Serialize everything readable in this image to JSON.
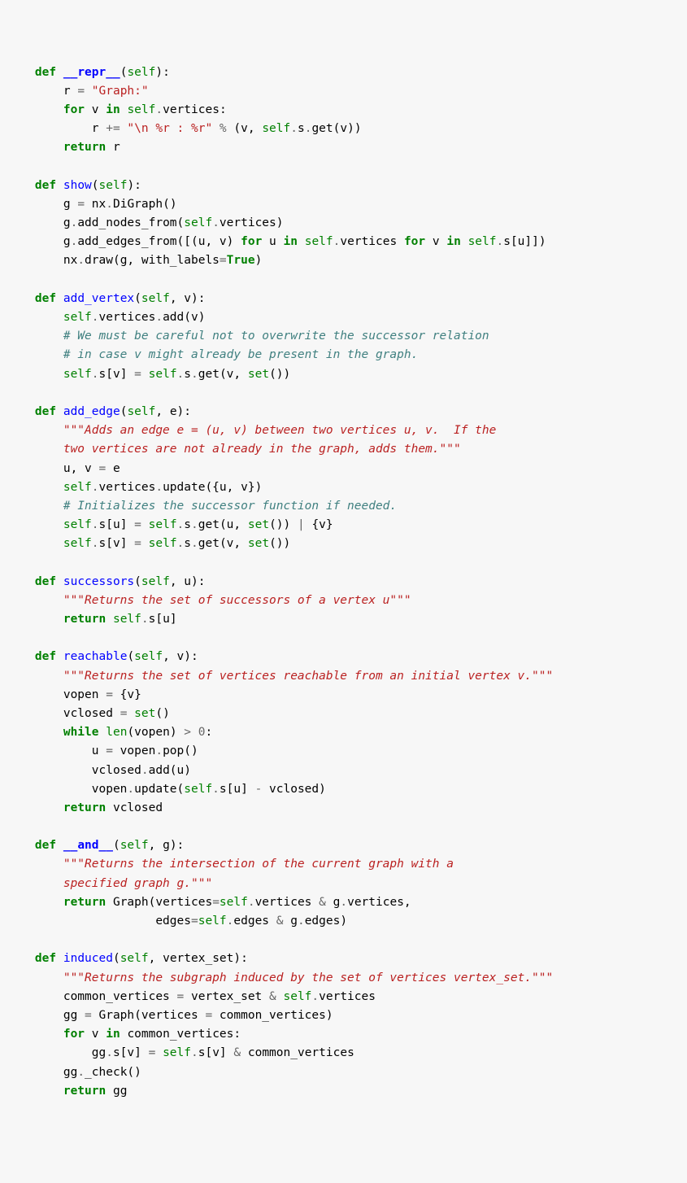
{
  "code_lines": [
    [
      [
        "    "
      ],
      [
        "kw",
        "def"
      ],
      [
        " "
      ],
      [
        "ufn",
        "__repr__"
      ],
      [
        "("
      ],
      [
        "self",
        "self"
      ],
      [
        "):"
      ]
    ],
    [
      [
        "        r "
      ],
      [
        "op",
        "="
      ],
      [
        " "
      ],
      [
        "str",
        "\"Graph:\""
      ]
    ],
    [
      [
        "        "
      ],
      [
        "kw",
        "for"
      ],
      [
        " v "
      ],
      [
        "kw",
        "in"
      ],
      [
        " "
      ],
      [
        "self",
        "self"
      ],
      [
        "op",
        "."
      ],
      [
        "vertices:"
      ]
    ],
    [
      [
        "            r "
      ],
      [
        "op",
        "+="
      ],
      [
        " "
      ],
      [
        "str",
        "\"\\n %r : %r\""
      ],
      [
        " "
      ],
      [
        "op",
        "%"
      ],
      [
        " (v, "
      ],
      [
        "self",
        "self"
      ],
      [
        "op",
        "."
      ],
      [
        "s"
      ],
      [
        "op",
        "."
      ],
      [
        "get(v))"
      ]
    ],
    [
      [
        "        "
      ],
      [
        "kw",
        "return"
      ],
      [
        " r"
      ]
    ],
    [
      [
        ""
      ]
    ],
    [
      [
        "    "
      ],
      [
        "kw",
        "def"
      ],
      [
        " "
      ],
      [
        "fn",
        "show"
      ],
      [
        "("
      ],
      [
        "self",
        "self"
      ],
      [
        "):"
      ]
    ],
    [
      [
        "        g "
      ],
      [
        "op",
        "="
      ],
      [
        " nx"
      ],
      [
        "op",
        "."
      ],
      [
        "DiGraph()"
      ]
    ],
    [
      [
        "        g"
      ],
      [
        "op",
        "."
      ],
      [
        "add_nodes_from("
      ],
      [
        "self",
        "self"
      ],
      [
        "op",
        "."
      ],
      [
        "vertices)"
      ]
    ],
    [
      [
        "        g"
      ],
      [
        "op",
        "."
      ],
      [
        "add_edges_from([(u, v) "
      ],
      [
        "kw",
        "for"
      ],
      [
        " u "
      ],
      [
        "kw",
        "in"
      ],
      [
        " "
      ],
      [
        "self",
        "self"
      ],
      [
        "op",
        "."
      ],
      [
        "vertices "
      ],
      [
        "kw",
        "for"
      ],
      [
        " v "
      ],
      [
        "kw",
        "in"
      ],
      [
        " "
      ],
      [
        "self",
        "self"
      ],
      [
        "op",
        "."
      ],
      [
        "s[u]])"
      ]
    ],
    [
      [
        "        nx"
      ],
      [
        "op",
        "."
      ],
      [
        "draw(g, with_labels"
      ],
      [
        "op",
        "="
      ],
      [
        "bool",
        "True"
      ],
      [
        ")"
      ]
    ],
    [
      [
        ""
      ]
    ],
    [
      [
        "    "
      ],
      [
        "kw",
        "def"
      ],
      [
        " "
      ],
      [
        "fn",
        "add_vertex"
      ],
      [
        "("
      ],
      [
        "self",
        "self"
      ],
      [
        ", v):"
      ]
    ],
    [
      [
        "        "
      ],
      [
        "self",
        "self"
      ],
      [
        "op",
        "."
      ],
      [
        "vertices"
      ],
      [
        "op",
        "."
      ],
      [
        "add(v)"
      ]
    ],
    [
      [
        "        "
      ],
      [
        "cm",
        "# We must be careful not to overwrite the successor relation"
      ]
    ],
    [
      [
        "        "
      ],
      [
        "cm",
        "# in case v might already be present in the graph."
      ]
    ],
    [
      [
        "        "
      ],
      [
        "self",
        "self"
      ],
      [
        "op",
        "."
      ],
      [
        "s[v] "
      ],
      [
        "op",
        "="
      ],
      [
        " "
      ],
      [
        "self",
        "self"
      ],
      [
        "op",
        "."
      ],
      [
        "s"
      ],
      [
        "op",
        "."
      ],
      [
        "get(v, "
      ],
      [
        "bi",
        "set"
      ],
      [
        "())"
      ]
    ],
    [
      [
        ""
      ]
    ],
    [
      [
        "    "
      ],
      [
        "kw",
        "def"
      ],
      [
        " "
      ],
      [
        "fn",
        "add_edge"
      ],
      [
        "("
      ],
      [
        "self",
        "self"
      ],
      [
        ", e):"
      ]
    ],
    [
      [
        "        "
      ],
      [
        "docf",
        "\"\"\"Adds an edge e = (u, v) between two vertices u, v.  If the"
      ]
    ],
    [
      [
        "        "
      ],
      [
        "docf",
        "two vertices are not already in the graph, adds them.\"\"\""
      ]
    ],
    [
      [
        "        u, v "
      ],
      [
        "op",
        "="
      ],
      [
        " e"
      ]
    ],
    [
      [
        "        "
      ],
      [
        "self",
        "self"
      ],
      [
        "op",
        "."
      ],
      [
        "vertices"
      ],
      [
        "op",
        "."
      ],
      [
        "update({u, v})"
      ]
    ],
    [
      [
        "        "
      ],
      [
        "cm",
        "# Initializes the successor function if needed."
      ]
    ],
    [
      [
        "        "
      ],
      [
        "self",
        "self"
      ],
      [
        "op",
        "."
      ],
      [
        "s[u] "
      ],
      [
        "op",
        "="
      ],
      [
        " "
      ],
      [
        "self",
        "self"
      ],
      [
        "op",
        "."
      ],
      [
        "s"
      ],
      [
        "op",
        "."
      ],
      [
        "get(u, "
      ],
      [
        "bi",
        "set"
      ],
      [
        "()) "
      ],
      [
        "op",
        "|"
      ],
      [
        " {v}"
      ]
    ],
    [
      [
        "        "
      ],
      [
        "self",
        "self"
      ],
      [
        "op",
        "."
      ],
      [
        "s[v] "
      ],
      [
        "op",
        "="
      ],
      [
        " "
      ],
      [
        "self",
        "self"
      ],
      [
        "op",
        "."
      ],
      [
        "s"
      ],
      [
        "op",
        "."
      ],
      [
        "get(v, "
      ],
      [
        "bi",
        "set"
      ],
      [
        "())"
      ]
    ],
    [
      [
        ""
      ]
    ],
    [
      [
        "    "
      ],
      [
        "kw",
        "def"
      ],
      [
        " "
      ],
      [
        "fn",
        "successors"
      ],
      [
        "("
      ],
      [
        "self",
        "self"
      ],
      [
        ", u):"
      ]
    ],
    [
      [
        "        "
      ],
      [
        "docf",
        "\"\"\"Returns the set of successors of a vertex u\"\"\""
      ]
    ],
    [
      [
        "        "
      ],
      [
        "kw",
        "return"
      ],
      [
        " "
      ],
      [
        "self",
        "self"
      ],
      [
        "op",
        "."
      ],
      [
        "s[u]"
      ]
    ],
    [
      [
        ""
      ]
    ],
    [
      [
        "    "
      ],
      [
        "kw",
        "def"
      ],
      [
        " "
      ],
      [
        "fn",
        "reachable"
      ],
      [
        "("
      ],
      [
        "self",
        "self"
      ],
      [
        ", v):"
      ]
    ],
    [
      [
        "        "
      ],
      [
        "docf",
        "\"\"\"Returns the set of vertices reachable from an initial vertex v.\"\"\""
      ]
    ],
    [
      [
        "        vopen "
      ],
      [
        "op",
        "="
      ],
      [
        " {v}"
      ]
    ],
    [
      [
        "        vclosed "
      ],
      [
        "op",
        "="
      ],
      [
        " "
      ],
      [
        "bi",
        "set"
      ],
      [
        "()"
      ]
    ],
    [
      [
        "        "
      ],
      [
        "kw",
        "while"
      ],
      [
        " "
      ],
      [
        "bi",
        "len"
      ],
      [
        "(vopen) "
      ],
      [
        "op",
        ">"
      ],
      [
        " "
      ],
      [
        "num",
        "0"
      ],
      [
        ":"
      ]
    ],
    [
      [
        "            u "
      ],
      [
        "op",
        "="
      ],
      [
        " vopen"
      ],
      [
        "op",
        "."
      ],
      [
        "pop()"
      ]
    ],
    [
      [
        "            vclosed"
      ],
      [
        "op",
        "."
      ],
      [
        "add(u)"
      ]
    ],
    [
      [
        "            vopen"
      ],
      [
        "op",
        "."
      ],
      [
        "update("
      ],
      [
        "self",
        "self"
      ],
      [
        "op",
        "."
      ],
      [
        "s[u] "
      ],
      [
        "op",
        "-"
      ],
      [
        " vclosed)"
      ]
    ],
    [
      [
        "        "
      ],
      [
        "kw",
        "return"
      ],
      [
        " vclosed"
      ]
    ],
    [
      [
        ""
      ]
    ],
    [
      [
        "    "
      ],
      [
        "kw",
        "def"
      ],
      [
        " "
      ],
      [
        "ufn",
        "__and__"
      ],
      [
        "("
      ],
      [
        "self",
        "self"
      ],
      [
        ", g):"
      ]
    ],
    [
      [
        "        "
      ],
      [
        "docf",
        "\"\"\"Returns the intersection of the current graph with a"
      ]
    ],
    [
      [
        "        "
      ],
      [
        "docf",
        "specified graph g.\"\"\""
      ]
    ],
    [
      [
        "        "
      ],
      [
        "kw",
        "return"
      ],
      [
        " Graph(vertices"
      ],
      [
        "op",
        "="
      ],
      [
        "self",
        "self"
      ],
      [
        "op",
        "."
      ],
      [
        "vertices "
      ],
      [
        "op",
        "&"
      ],
      [
        " g"
      ],
      [
        "op",
        "."
      ],
      [
        "vertices,"
      ]
    ],
    [
      [
        "                     edges"
      ],
      [
        "op",
        "="
      ],
      [
        "self",
        "self"
      ],
      [
        "op",
        "."
      ],
      [
        "edges "
      ],
      [
        "op",
        "&"
      ],
      [
        " g"
      ],
      [
        "op",
        "."
      ],
      [
        "edges)"
      ]
    ],
    [
      [
        ""
      ]
    ],
    [
      [
        "    "
      ],
      [
        "kw",
        "def"
      ],
      [
        " "
      ],
      [
        "fn",
        "induced"
      ],
      [
        "("
      ],
      [
        "self",
        "self"
      ],
      [
        ", vertex_set):"
      ]
    ],
    [
      [
        "        "
      ],
      [
        "docf",
        "\"\"\"Returns the subgraph induced by the set of vertices vertex_set.\"\"\""
      ]
    ],
    [
      [
        "        common_vertices "
      ],
      [
        "op",
        "="
      ],
      [
        " vertex_set "
      ],
      [
        "op",
        "&"
      ],
      [
        " "
      ],
      [
        "self",
        "self"
      ],
      [
        "op",
        "."
      ],
      [
        "vertices"
      ]
    ],
    [
      [
        "        gg "
      ],
      [
        "op",
        "="
      ],
      [
        " Graph(vertices "
      ],
      [
        "op",
        "="
      ],
      [
        " common_vertices)"
      ]
    ],
    [
      [
        "        "
      ],
      [
        "kw",
        "for"
      ],
      [
        " v "
      ],
      [
        "kw",
        "in"
      ],
      [
        " common_vertices:"
      ]
    ],
    [
      [
        "            gg"
      ],
      [
        "op",
        "."
      ],
      [
        "s[v] "
      ],
      [
        "op",
        "="
      ],
      [
        " "
      ],
      [
        "self",
        "self"
      ],
      [
        "op",
        "."
      ],
      [
        "s[v] "
      ],
      [
        "op",
        "&"
      ],
      [
        " common_vertices"
      ]
    ],
    [
      [
        "        gg"
      ],
      [
        "op",
        "."
      ],
      [
        "_check()"
      ]
    ],
    [
      [
        "        "
      ],
      [
        "kw",
        "return"
      ],
      [
        " gg"
      ]
    ]
  ]
}
